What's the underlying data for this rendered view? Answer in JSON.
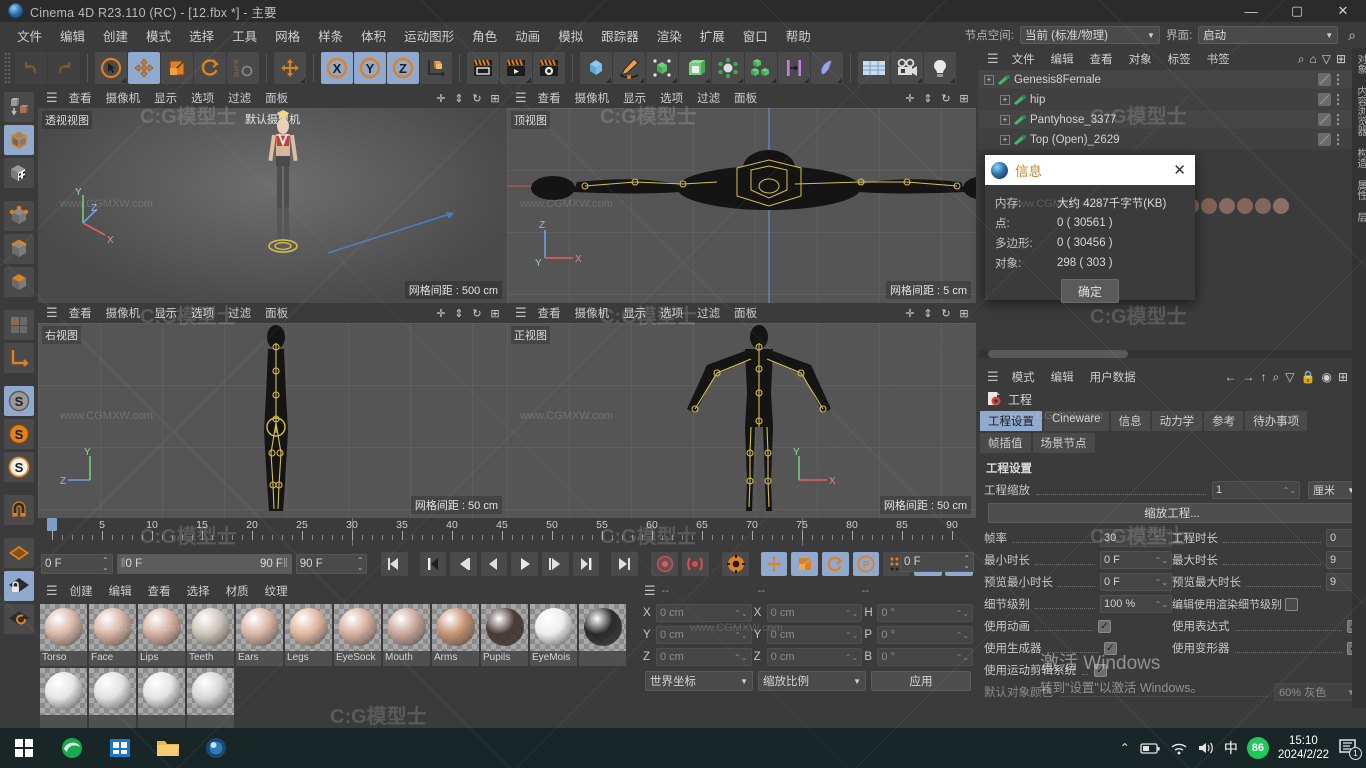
{
  "window": {
    "title": "Cinema 4D R23.110 (RC) - [12.fbx *] - 主要",
    "minimize": "—",
    "maximize": "▢",
    "close": "✕"
  },
  "menubar": {
    "items": [
      "文件",
      "编辑",
      "创建",
      "模式",
      "选择",
      "工具",
      "网格",
      "样条",
      "体积",
      "运动图形",
      "角色",
      "动画",
      "模拟",
      "跟踪器",
      "渲染",
      "扩展",
      "窗口",
      "帮助"
    ],
    "node_space_label": "节点空间:",
    "node_space_value": "当前 (标准/物理)",
    "layout_label": "界面:",
    "layout_value": "启动",
    "search_icon": "search-icon"
  },
  "viewports": [
    {
      "name": "透视视图",
      "menu": [
        "查看",
        "摄像机",
        "显示",
        "选项",
        "过滤",
        "面板"
      ],
      "grid": "网格间距 : 500 cm",
      "camera": "默认摄像机"
    },
    {
      "name": "顶视图",
      "menu": [
        "查看",
        "摄像机",
        "显示",
        "选项",
        "过滤",
        "面板"
      ],
      "grid": "网格间距 : 5 cm",
      "camera": ""
    },
    {
      "name": "右视图",
      "menu": [
        "查看",
        "摄像机",
        "显示",
        "选项",
        "过滤",
        "面板"
      ],
      "grid": "网格间距 : 50 cm",
      "camera": ""
    },
    {
      "name": "正视图",
      "menu": [
        "查看",
        "摄像机",
        "显示",
        "选项",
        "过滤",
        "面板"
      ],
      "grid": "网格间距 : 50 cm",
      "camera": ""
    }
  ],
  "timeline": {
    "ticks": [
      0,
      5,
      10,
      15,
      20,
      25,
      30,
      35,
      40,
      45,
      50,
      55,
      60,
      65,
      70,
      75,
      80,
      85,
      90
    ],
    "current_frame": "0 F",
    "range_start": "0 F",
    "range_end": "90 F",
    "end_frame": "90 F",
    "right_frame": "0 F",
    "playhead_frame": 0
  },
  "transport": {
    "buttons": [
      "goto-start",
      "frame-back",
      "step-back",
      "play",
      "step-forward",
      "frame-forward",
      "goto-end"
    ],
    "record_label": "record",
    "autokey_label": "autokey",
    "keyframe_modes": [
      "位置",
      "缩放",
      "旋转",
      "参数",
      "点级别"
    ]
  },
  "materials": {
    "menu": [
      "创建",
      "编辑",
      "查看",
      "选择",
      "材质",
      "纹理"
    ],
    "items": [
      {
        "name": "Torso",
        "color": "#d9b8a8"
      },
      {
        "name": "Face",
        "color": "#d8b4a4"
      },
      {
        "name": "Lips",
        "color": "#d6b1a2"
      },
      {
        "name": "Teeth",
        "color": "#cfc6ba"
      },
      {
        "name": "Ears",
        "color": "#d9b6a6"
      },
      {
        "name": "Legs",
        "color": "#e0b79f"
      },
      {
        "name": "EyeSock",
        "color": "#d6b0a0"
      },
      {
        "name": "Mouth",
        "color": "#c9a79b"
      },
      {
        "name": "Arms",
        "color": "#c69272"
      },
      {
        "name": "Pupils",
        "color": "#4a3b38"
      },
      {
        "name": "EyeMois",
        "color": "#eeeeee"
      },
      {
        "name": "",
        "color": "#2a2a2a"
      },
      {
        "name": "",
        "color": "#e6e6e6"
      },
      {
        "name": "",
        "color": "#e2e2e2"
      },
      {
        "name": "",
        "color": "#e4e4e4"
      },
      {
        "name": "",
        "color": "#d8d8d8"
      }
    ]
  },
  "coordinates": {
    "header": [
      "--",
      "--",
      "--"
    ],
    "rows": [
      {
        "lab1": "X",
        "v1": "0 cm",
        "lab2": "X",
        "v2": "0 cm",
        "lab3": "H",
        "v3": "0 °"
      },
      {
        "lab1": "Y",
        "v1": "0 cm",
        "lab2": "Y",
        "v2": "0 cm",
        "lab3": "P",
        "v3": "0 °"
      },
      {
        "lab1": "Z",
        "v1": "0 cm",
        "lab2": "Z",
        "v2": "0 cm",
        "lab3": "B",
        "v3": "0 °"
      }
    ],
    "space": "世界坐标",
    "mode": "缩放比例",
    "apply": "应用"
  },
  "object_manager": {
    "menu": [
      "文件",
      "编辑",
      "查看",
      "对象",
      "标签",
      "书签"
    ],
    "rows": [
      {
        "label": "Genesis8Female",
        "indent": 0
      },
      {
        "label": "hip",
        "indent": 1
      },
      {
        "label": "Pantyhose_3377",
        "indent": 1
      },
      {
        "label": "Top (Open)_2629",
        "indent": 1
      }
    ]
  },
  "info_dialog": {
    "title": "信息",
    "close": "✕",
    "rows": [
      {
        "key": "内存:",
        "value": "大约 4287千字节(KB)"
      },
      {
        "key": "点:",
        "value": "0 ( 30561 )"
      },
      {
        "key": "多边形:",
        "value": "0 ( 30456 )"
      },
      {
        "key": "对象:",
        "value": "298 ( 303 )"
      }
    ],
    "ok": "确定"
  },
  "attribute_manager": {
    "menu": [
      "模式",
      "编辑",
      "用户数据"
    ],
    "object_title": "工程",
    "tabs_row1": [
      "工程设置",
      "Cineware",
      "信息",
      "动力学",
      "参考",
      "待办事项"
    ],
    "tabs_row2": [
      "帧插值",
      "场景节点"
    ],
    "active_tab": "工程设置",
    "section": "工程设置",
    "scale_label": "工程缩放",
    "scale_value": "1",
    "scale_unit": "厘米",
    "scale_button": "缩放工程...",
    "fields": [
      {
        "label": "帧率",
        "value": "30",
        "label2": "工程时长",
        "value2": "0"
      },
      {
        "label": "最小时长",
        "value": "0 F",
        "label2": "最大时长",
        "value2": "9"
      },
      {
        "label": "预览最小时长",
        "value": "0 F",
        "label2": "预览最大时长",
        "value2": "9"
      }
    ],
    "lod_label": "细节级别",
    "lod_value": "100 %",
    "lod_right_label": "编辑使用渲染细节级别",
    "checks": [
      {
        "label": "使用动画",
        "checked": true,
        "label2": "使用表达式",
        "checked2": true
      },
      {
        "label": "使用生成器",
        "checked": true,
        "label2": "使用变形器",
        "checked2": true
      },
      {
        "label": "使用运动剪辑系统",
        "checked": true,
        "label2": "",
        "checked2": null
      }
    ],
    "last_label": "默认对象颜色",
    "last_value": "60% 灰色"
  },
  "vertical_tabs": [
    "对象",
    "内容浏览器",
    "构造",
    "属性",
    "层"
  ],
  "taskbar": {
    "start_icon": "windows-start-icon",
    "apps": [
      "edge-browser-icon",
      "store-icon",
      "file-explorer-icon",
      "cinema4d-icon"
    ],
    "tray": [
      "chevron-up-icon",
      "battery-icon",
      "wifi-icon",
      "volume-icon"
    ],
    "ime": "中",
    "badge": "86",
    "time": "15:10",
    "date": "2024/2/22",
    "notification_count": "1"
  },
  "watermarks": {
    "big": "C:G模型士",
    "small": "www.CGMXW.com",
    "activate_title": "激活 Windows",
    "activate_sub": "转到\"设置\"以激活 Windows。"
  },
  "colors": {
    "accent_orange": "#e08020",
    "accent_blue": "#8fa9cf",
    "panel": "#3b3b3b",
    "field": "#4a4a4a"
  }
}
